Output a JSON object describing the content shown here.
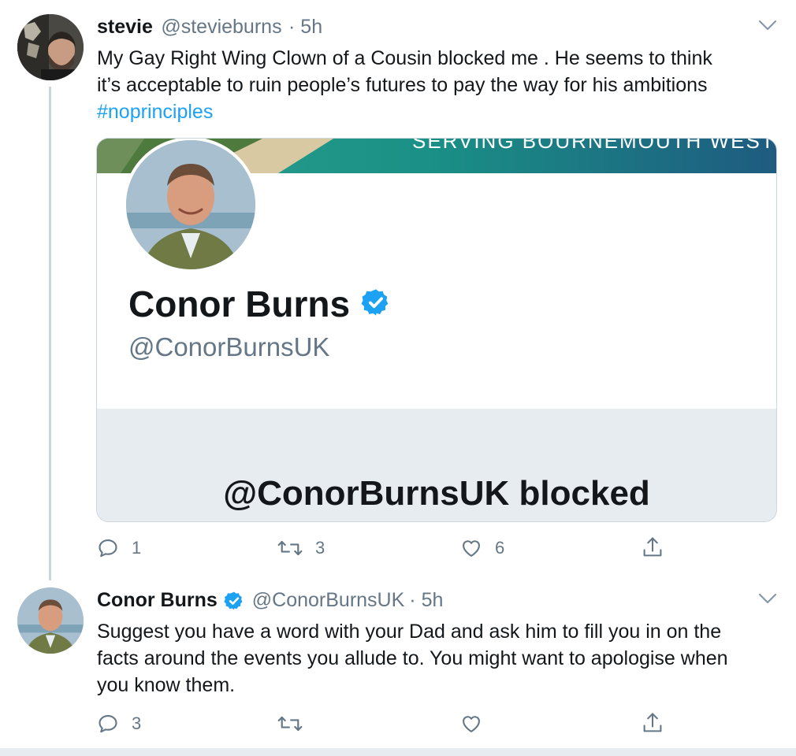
{
  "tweet1": {
    "name": "stevie",
    "handle": "@stevieburns",
    "time": "· 5h",
    "text_line1": "My Gay Right Wing Clown of a Cousin blocked me . He seems to think",
    "text_line2": "it’s acceptable to ruin people’s futures to pay the way for his ambitions",
    "hashtag": "#noprinciples",
    "card": {
      "banner_text": "SERVING BOURNEMOUTH WEST",
      "profile_name": "Conor Burns",
      "profile_handle": "@ConorBurnsUK",
      "blocked_text": "@ConorBurnsUK blocked"
    },
    "actions": {
      "replies": "1",
      "retweets": "3",
      "likes": "6"
    }
  },
  "tweet2": {
    "name": "Conor Burns",
    "handle": "@ConorBurnsUK",
    "time": "· 5h",
    "text_line1": "Suggest you have a word with your Dad and ask him to fill you in on the",
    "text_line2": "facts around the events you allude to. You might want to apologise when",
    "text_line3": "you know them.",
    "actions": {
      "replies": "3"
    }
  },
  "colors": {
    "link": "#1da1f2",
    "verified": "#1da1f2",
    "muted": "#657786",
    "border": "#ccd6dd",
    "blocked_bg": "#e6ecf0"
  }
}
